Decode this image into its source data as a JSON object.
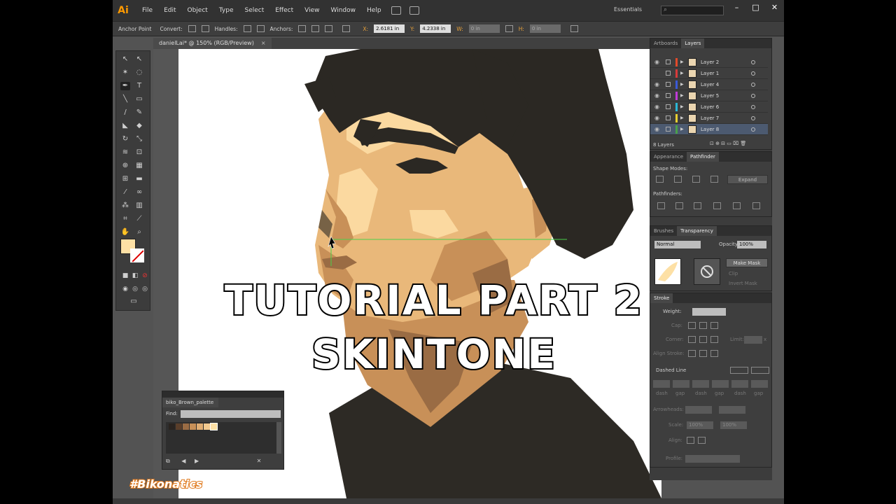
{
  "app": {
    "logo": "Ai",
    "menu": [
      "File",
      "Edit",
      "Object",
      "Type",
      "Select",
      "Effect",
      "View",
      "Window",
      "Help"
    ],
    "workspace": "Essentials",
    "window_buttons": [
      "–",
      "□",
      "✕"
    ]
  },
  "control_bar": {
    "anchor_point": "Anchor Point",
    "convert": "Convert:",
    "handles": "Handles:",
    "anchors": "Anchors:",
    "x_label": "X:",
    "x_value": "2.6181 in",
    "y_label": "Y:",
    "y_value": "4.2338 in",
    "w_label": "W:",
    "w_value": "0 in",
    "h_label": "H:",
    "h_value": "0 in"
  },
  "document": {
    "tab_title": "danielLai* @ 150% (RGB/Preview)",
    "close": "×"
  },
  "swatch_panel": {
    "title": "biko_Brown_palette",
    "find_label": "Find:",
    "swatches": [
      "#2a2420",
      "#5a3e2a",
      "#9a6c44",
      "#c89058",
      "#e0ad73",
      "#f2c98f",
      "#fde0a5"
    ]
  },
  "layers_panel": {
    "tabs": [
      "Artboards",
      "Layers"
    ],
    "active_tab": "Layers",
    "layers": [
      {
        "name": "Layer 2",
        "color": "#e34a2a",
        "visible": true
      },
      {
        "name": "Layer 1",
        "color": "#d83a3a",
        "visible": false
      },
      {
        "name": "Layer 4",
        "color": "#3a5ad8",
        "visible": true
      },
      {
        "name": "Layer 5",
        "color": "#c03ad8",
        "visible": true
      },
      {
        "name": "Layer 6",
        "color": "#2ab8d8",
        "visible": true
      },
      {
        "name": "Layer 7",
        "color": "#e8d030",
        "visible": true
      },
      {
        "name": "Layer 8",
        "color": "#4aa04a",
        "visible": true,
        "selected": true
      }
    ],
    "count": "8 Layers"
  },
  "pathfinder_panel": {
    "tabs": [
      "Appearance",
      "Pathfinder"
    ],
    "active_tab": "Pathfinder",
    "shape_modes": "Shape Modes:",
    "expand": "Expand",
    "pathfinders": "Pathfinders:"
  },
  "transparency_panel": {
    "tabs": [
      "Brushes",
      "Transparency"
    ],
    "active_tab": "Transparency",
    "blend_mode": "Normal",
    "opacity_label": "Opacity:",
    "opacity_value": "100%",
    "make_mask": "Make Mask",
    "clip": "Clip",
    "invert_mask": "Invert Mask"
  },
  "stroke_panel": {
    "title": "Stroke",
    "weight": "Weight:",
    "cap": "Cap:",
    "corner": "Corner:",
    "limit": "Limit:",
    "limit_x": "x",
    "align_stroke": "Align Stroke:",
    "dashed_line": "Dashed Line",
    "dash_labels": [
      "dash",
      "gap",
      "dash",
      "gap",
      "dash",
      "gap"
    ],
    "arrowheads": "Arrowheads:",
    "scale": "Scale:",
    "scale_1": "100%",
    "scale_2": "100%",
    "align": "Align:",
    "profile": "Profile:"
  },
  "overlay": {
    "line1": "TUTORIAL PART 2",
    "line2": "SKINTONE",
    "watermark": "#Bikonatics"
  },
  "colors": {
    "fill": "#fde0a5",
    "hair": "#2b2823",
    "skin_dark": "#9a6c44",
    "skin_mid": "#c89058",
    "skin_light": "#e9b87a",
    "skin_pale": "#fbd9a0",
    "guide": "#4ad04a"
  }
}
